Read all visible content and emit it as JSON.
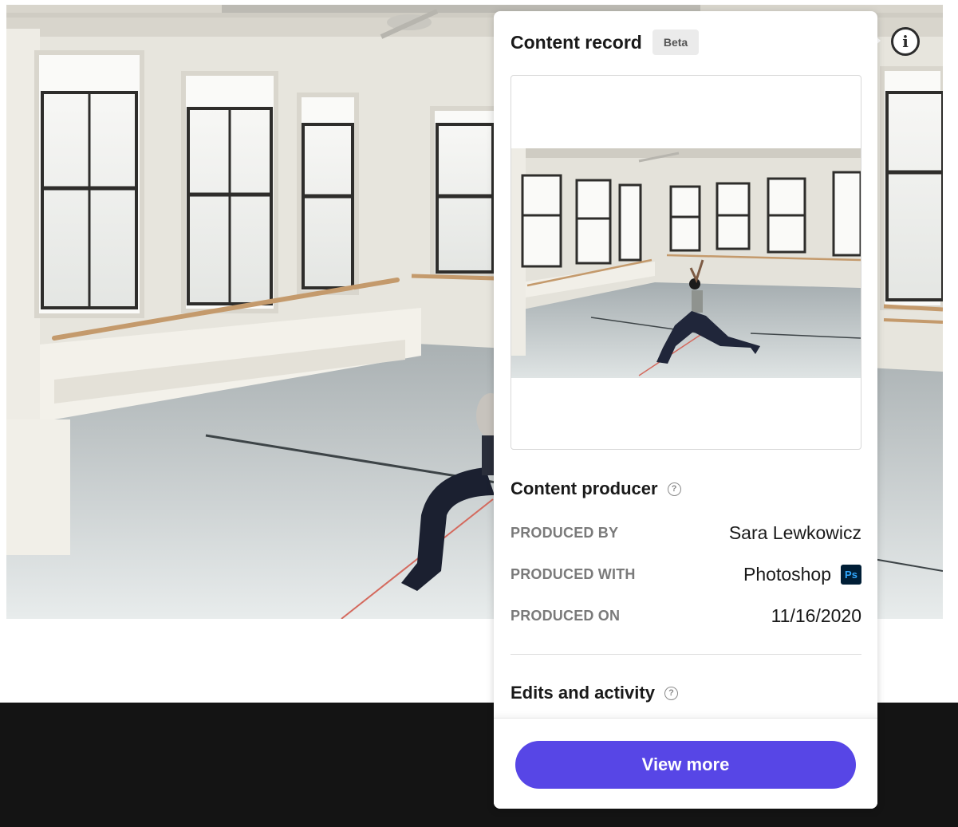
{
  "panel": {
    "title": "Content record",
    "badge": "Beta"
  },
  "producer": {
    "heading": "Content producer",
    "rows": [
      {
        "label": "PRODUCED BY",
        "value": "Sara Lewkowicz"
      },
      {
        "label": "PRODUCED WITH",
        "value": "Photoshop",
        "app_icon": "Ps"
      },
      {
        "label": "PRODUCED ON",
        "value": "11/16/2020"
      }
    ]
  },
  "activity": {
    "heading": "Edits and activity"
  },
  "footer": {
    "view_more_label": "View more"
  },
  "icons": {
    "info": "i",
    "help": "?"
  },
  "colors": {
    "accent": "#5746e6",
    "photoshop_bg": "#001e36",
    "photoshop_fg": "#31a8ff",
    "footer_bg": "#141414"
  }
}
